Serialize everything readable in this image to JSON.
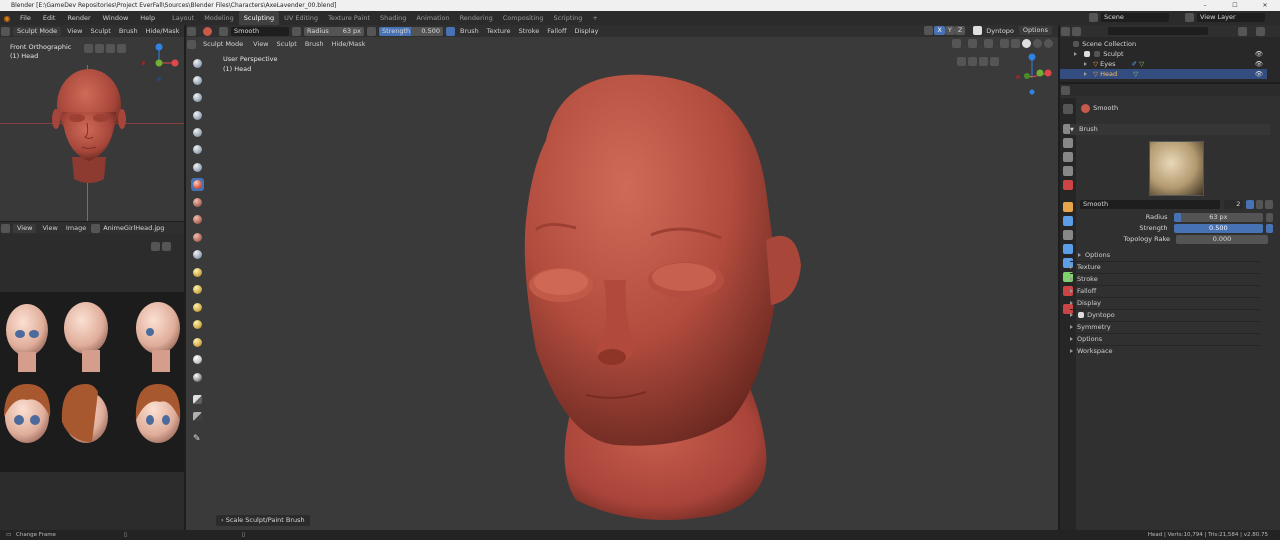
{
  "window": {
    "title": "Blender [E:\\GameDev Repositories\\Project EverFall\\Sources\\Blender Files\\Characters\\AxeLavender_00.blend]",
    "controls": [
      "–",
      "☐",
      "✕"
    ]
  },
  "menu": {
    "items": [
      "File",
      "Edit",
      "Render",
      "Window",
      "Help"
    ],
    "workspaces": [
      "Layout",
      "Modeling",
      "Sculpting",
      "UV Editing",
      "Texture Paint",
      "Shading",
      "Animation",
      "Rendering",
      "Compositing",
      "Scripting"
    ],
    "active_workspace": "Sculpting",
    "add_tab": "+",
    "scene_label": "Scene",
    "view_layer_label": "View Layer"
  },
  "tool_header": {
    "brush_name": "Smooth",
    "radius_label": "Radius",
    "radius_value": "63 px",
    "strength_label": "Strength",
    "strength_value": "0.500",
    "menus": [
      "Brush",
      "Texture",
      "Stroke",
      "Falloff",
      "Display"
    ],
    "axes": [
      "X",
      "Y",
      "Z"
    ],
    "dyntopo_label": "Dyntopo",
    "options_label": "Options"
  },
  "viewport_header": {
    "mode": "Sculpt Mode",
    "menus": [
      "View",
      "Sculpt",
      "Brush",
      "Hide/Mask"
    ]
  },
  "small_viewport": {
    "mode": "Sculpt Mode",
    "menus": [
      "View",
      "Sculpt",
      "Brush",
      "Hide/Mask"
    ],
    "view_name": "Front Orthographic",
    "object": "(1) Head"
  },
  "main_viewport": {
    "view_name": "User Perspective",
    "object": "(1) Head",
    "last_operation": "Scale Sculpt/Paint Brush"
  },
  "image_editor": {
    "menus": [
      "View",
      "View",
      "Image"
    ],
    "image_name": "AnimeGirlHead.jpg"
  },
  "outliner": {
    "collection": "Scene Collection",
    "items": [
      {
        "name": "Sculpt",
        "level": 1
      },
      {
        "name": "Eyes",
        "level": 2
      },
      {
        "name": "Head",
        "level": 2,
        "selected": true
      }
    ]
  },
  "properties": {
    "active_brush": "Smooth",
    "brush_section": "Brush",
    "brush_field": "Smooth",
    "brush_users": "2",
    "radius_label": "Radius",
    "radius_value": "63 px",
    "strength_label": "Strength",
    "strength_value": "0.500",
    "strength_fraction": 0.5,
    "topology_rake_label": "Topology Rake",
    "topology_rake_value": "0.000",
    "sub_options": "Options",
    "sections": [
      "Texture",
      "Stroke",
      "Falloff",
      "Display",
      "Dyntopo",
      "Symmetry",
      "Options",
      "Workspace"
    ]
  },
  "statusbar": {
    "left": "Change Frame",
    "right": "Head | Verts:10,794 | Tris:21,584 | v2.80.75"
  },
  "colors": {
    "accent": "#4772b3",
    "head": "#b44e40",
    "axis_x": "#e2474b",
    "axis_y": "#6fb133",
    "axis_z": "#2f83e3"
  }
}
